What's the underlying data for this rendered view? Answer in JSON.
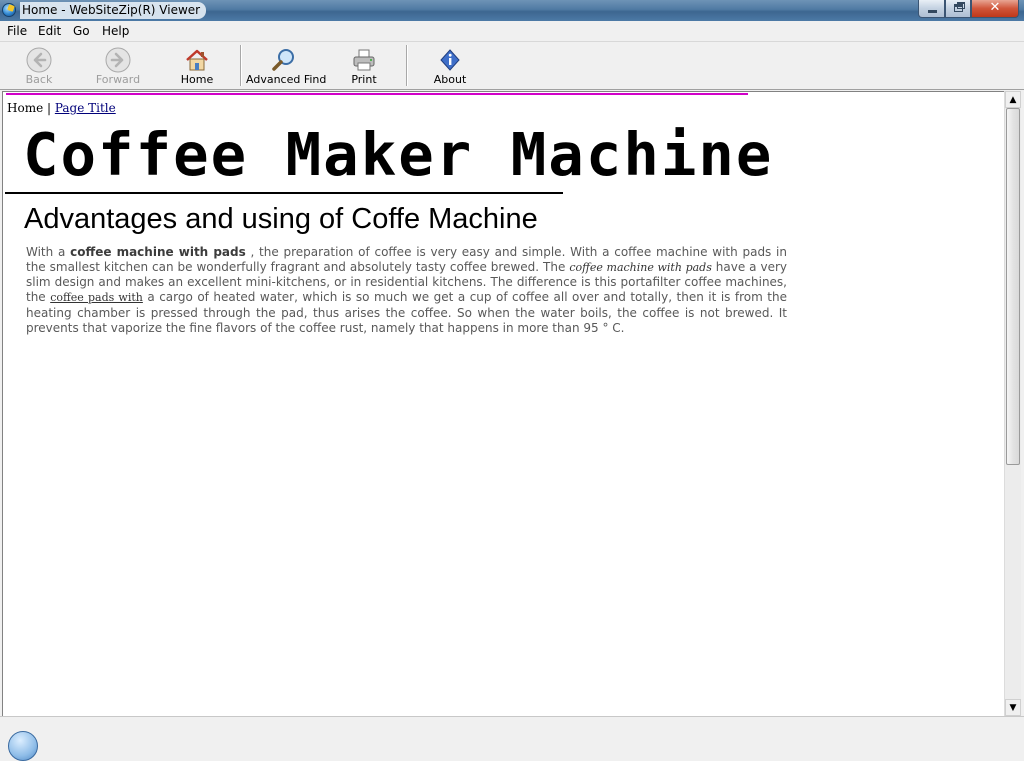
{
  "window": {
    "title": "Home - WebSiteZip(R) Viewer",
    "controls": {
      "minimize": "",
      "maximize": "",
      "close": "✕"
    }
  },
  "menu": {
    "items": [
      "File",
      "Edit",
      "Go",
      "Help"
    ]
  },
  "toolbar": {
    "back": {
      "label": "Back",
      "icon": "back-arrow-icon",
      "enabled": false
    },
    "forward": {
      "label": "Forward",
      "icon": "forward-arrow-icon",
      "enabled": false
    },
    "home": {
      "label": "Home",
      "icon": "home-icon"
    },
    "advanced_find": {
      "label": "Advanced Find",
      "icon": "magnifier-icon"
    },
    "print": {
      "label": "Print",
      "icon": "printer-icon"
    },
    "about": {
      "label": "About",
      "icon": "info-icon"
    }
  },
  "page": {
    "breadcrumb": {
      "home": "Home",
      "separator": " | ",
      "current": "Page Title"
    },
    "title": "Coffee Maker Machine",
    "heading": "Advantages and using of Coffe Machine",
    "article": {
      "intro": "With a ",
      "bold1": "coffee machine with pads",
      "p1": " , the preparation of coffee is very easy and simple. With a coffee machine with pads in the smallest kitchen can be wonderfully fragrant and absolutely tasty coffee brewed. The ",
      "italic1": "coffee machine with pads",
      "p2": " have a very slim design and makes an excellent mini-kitchens, or in residential kitchens. The difference is this portafilter coffee machines, the ",
      "link1": "coffee pads with",
      "p3": " a cargo of heated water, which is so much we get a cup of coffee all over and totally, then it is from the heating chamber is pressed through the pad, thus arises the coffee. So when the water boils, the coffee is not brewed. It prevents that vaporize the fine flavors of the coffee rust, namely that happens in more than 95 ° C."
    }
  },
  "scrollbar": {
    "up": "▲",
    "down": "▼"
  },
  "colors": {
    "accent_line": "#d100c8",
    "link": "#00007a"
  }
}
